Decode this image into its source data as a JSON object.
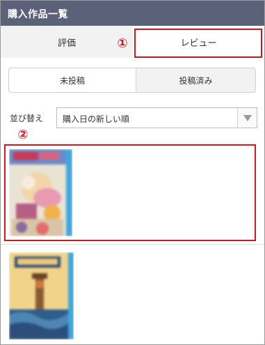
{
  "header": {
    "title": "購入作品一覧"
  },
  "tabs": [
    {
      "label": "評価"
    },
    {
      "label": "レビュー"
    }
  ],
  "segments": [
    {
      "label": "未投稿"
    },
    {
      "label": "投稿済み"
    }
  ],
  "sort": {
    "label": "並び替え",
    "selected": "購入日の新しい順"
  },
  "annotations": [
    {
      "number": "①"
    },
    {
      "number": "②"
    }
  ],
  "colors": {
    "header_bg": "#5a6178",
    "annotation_red": "#d6161c"
  },
  "icons": {
    "select_arrow": "chevron-down-icon"
  }
}
